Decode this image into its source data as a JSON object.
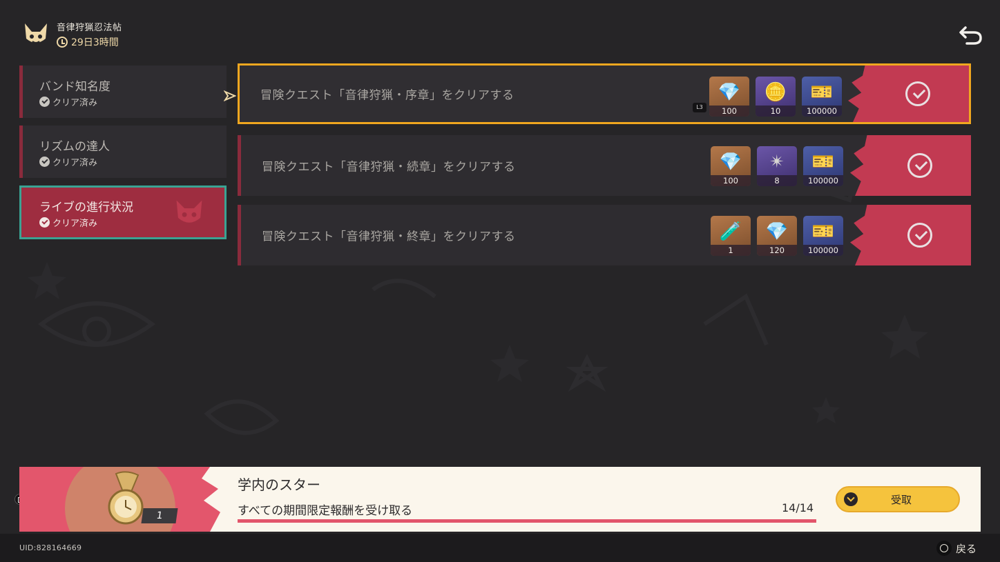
{
  "header": {
    "event_title": "音律狩猟忍法帖",
    "time_left": "29日3時間"
  },
  "sidebar": {
    "items": [
      {
        "label": "バンド知名度",
        "status": "クリア済み"
      },
      {
        "label": "リズムの達人",
        "status": "クリア済み"
      },
      {
        "label": "ライブの進行状況",
        "status": "クリア済み"
      }
    ]
  },
  "quests": [
    {
      "label": "冒険クエスト「音律狩猟・序章」をクリアする",
      "rewards": [
        {
          "icon": "crystal-icon",
          "qty": "100"
        },
        {
          "icon": "gold-ingot-icon",
          "qty": "10"
        },
        {
          "icon": "currency-ticket-icon",
          "qty": "100000"
        }
      ]
    },
    {
      "label": "冒険クエスト「音律狩猟・続章」をクリアする",
      "rewards": [
        {
          "icon": "crystal-icon",
          "qty": "100"
        },
        {
          "icon": "chip-icon",
          "qty": "8"
        },
        {
          "icon": "currency-ticket-icon",
          "qty": "100000"
        }
      ]
    },
    {
      "label": "冒険クエスト「音律狩猟・終章」をクリアする",
      "rewards": [
        {
          "icon": "potion-icon",
          "qty": "1"
        },
        {
          "icon": "crystal-icon",
          "qty": "120"
        },
        {
          "icon": "currency-ticket-icon",
          "qty": "100000"
        }
      ]
    }
  ],
  "banner": {
    "reward_count": "1",
    "title": "学内のスター",
    "description": "すべての期間限定報酬を受け取る",
    "progress_text": "14/14",
    "progress": 1.0,
    "claim_label": "受取"
  },
  "footer": {
    "uid": "UID:828164669",
    "back_label": "戻る"
  },
  "colors": {
    "accent_red": "#c23a52",
    "selection": "#f0a71f",
    "active_border": "#3aa393",
    "claim_yellow": "#f5c33d"
  }
}
